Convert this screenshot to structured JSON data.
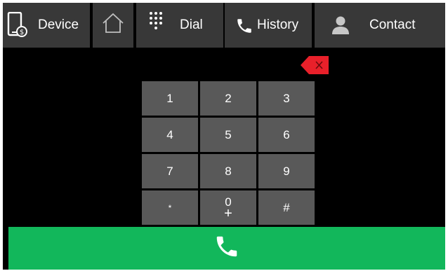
{
  "nav": {
    "device": {
      "label": "Device",
      "icon": "phone-device-icon"
    },
    "home": {
      "icon": "home-icon"
    },
    "dial": {
      "label": "Dial",
      "icon": "dialpad-icon"
    },
    "history": {
      "label": "History",
      "icon": "phone-handset-icon"
    },
    "contact": {
      "label": "Contact",
      "icon": "person-icon"
    }
  },
  "backspace": {
    "icon": "backspace-icon",
    "color": "#e8202a"
  },
  "keypad": {
    "keys": [
      {
        "main": "1",
        "sub": ""
      },
      {
        "main": "2",
        "sub": ""
      },
      {
        "main": "3",
        "sub": ""
      },
      {
        "main": "4",
        "sub": ""
      },
      {
        "main": "5",
        "sub": ""
      },
      {
        "main": "6",
        "sub": ""
      },
      {
        "main": "7",
        "sub": ""
      },
      {
        "main": "8",
        "sub": ""
      },
      {
        "main": "9",
        "sub": ""
      },
      {
        "main": "*",
        "sub": ""
      },
      {
        "main": "0",
        "sub": "+"
      },
      {
        "main": "#",
        "sub": ""
      }
    ]
  },
  "call": {
    "icon": "call-icon",
    "color": "#12b75b"
  }
}
